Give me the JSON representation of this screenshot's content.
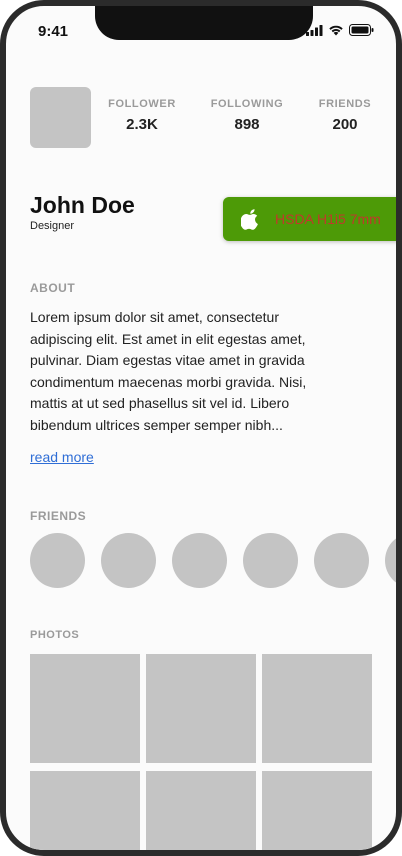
{
  "status_bar": {
    "time": "9:41",
    "icons": [
      "cellular-signal-icon",
      "wifi-icon",
      "battery-icon"
    ]
  },
  "profile": {
    "stats": [
      {
        "label": "FOLLOWER",
        "value": "2.3K"
      },
      {
        "label": "FOLLOWING",
        "value": "898"
      },
      {
        "label": "FRIENDS",
        "value": "200"
      }
    ],
    "name": "John Doe",
    "role": "Designer"
  },
  "buy_button": {
    "label": "HSDA H1i5 7mm",
    "icon": "apple-icon",
    "background": "#4d9a07",
    "text_color": "#c0392b"
  },
  "about": {
    "title": "ABOUT",
    "lines": [
      "Lorem ipsum dolor sit amet, consectetur",
      "adipiscing elit. Est amet in elit egestas amet,",
      "pulvinar. Diam egestas vitae amet in gravida",
      "condimentum maecenas morbi gravida. Nisi,",
      "mattis at ut sed phasellus sit vel id. Libero",
      "bibendum ultrices semper semper nibh..."
    ],
    "read_more": "read more"
  },
  "friends": {
    "title": "FRIENDS",
    "count_visible": 6
  },
  "photos": {
    "title": "PHOTOS",
    "count_visible": 6
  },
  "colors": {
    "placeholder": "#c4c4c4",
    "muted_label": "#9a9a9a",
    "link": "#2f6ed6",
    "frame": "#2b2b2b"
  }
}
